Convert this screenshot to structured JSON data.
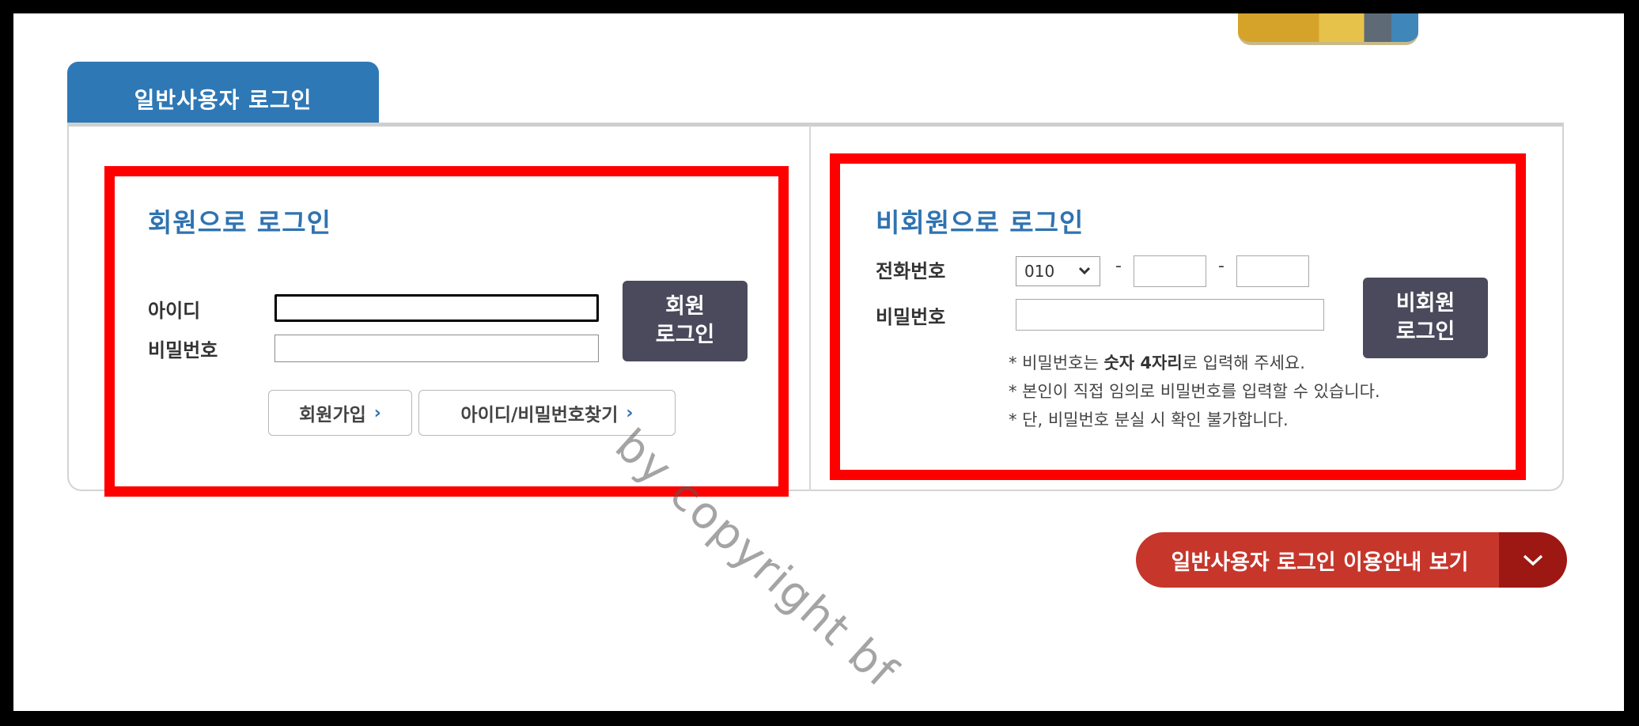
{
  "tab": {
    "label": "일반사용자 로그인"
  },
  "member_login": {
    "title": "회원으로 로그인",
    "id_label": "아이디",
    "password_label": "비밀번호",
    "id_value": "",
    "password_value": "",
    "login_button_line1": "회원",
    "login_button_line2": "로그인",
    "signup_label": "회원가입",
    "find_label": "아이디/비밀번호찾기"
  },
  "guest_login": {
    "title": "비회원으로 로그인",
    "phone_label": "전화번호",
    "phone_prefix_selected": "010",
    "phone_dash": "-",
    "phone_middle_value": "",
    "phone_last_value": "",
    "password_label": "비밀번호",
    "password_value": "",
    "login_button_line1": "비회원",
    "login_button_line2": "로그인",
    "note1_prefix": "* 비밀번호는 ",
    "note1_strong": "숫자 4자리",
    "note1_suffix": "로 입력해 주세요.",
    "note2": "* 본인이 직접 임의로 비밀번호를 입력할 수 있습니다.",
    "note3": "* 단, 비밀번호 분실 시 확인 불가합니다."
  },
  "guide_button": {
    "label": "일반사용자 로그인 이용안내 보기",
    "icon": "chevron-down-icon"
  },
  "watermark": "by copyright bf",
  "colors": {
    "tab_blue": "#2f78b6",
    "title_blue": "#2f73b1",
    "login_button": "#4b4a5c",
    "guide_red": "#c7362b",
    "guide_dark_red": "#9d1713",
    "annotation_red": "#ff0000"
  }
}
